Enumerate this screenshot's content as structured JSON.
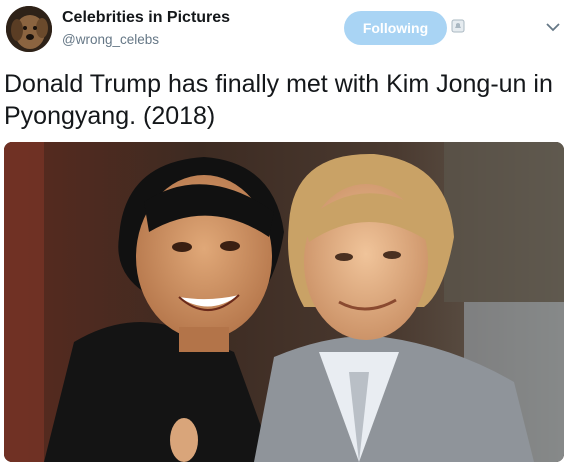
{
  "account": {
    "display_name": "Celebrities in Pictures",
    "handle": "@wrong_celebs",
    "avatar_icon": "dog-avatar"
  },
  "actions": {
    "follow_label": "Following",
    "notification_icon": "notification-bell-icon",
    "menu_icon": "chevron-down-icon"
  },
  "tweet": {
    "text": "Donald Trump has finally met with Kim Jong-un in Pyongyang. (2018)"
  },
  "colors": {
    "follow_button_bg": "#a9d4f4",
    "handle_text": "#657786",
    "body_text": "#14171a"
  }
}
